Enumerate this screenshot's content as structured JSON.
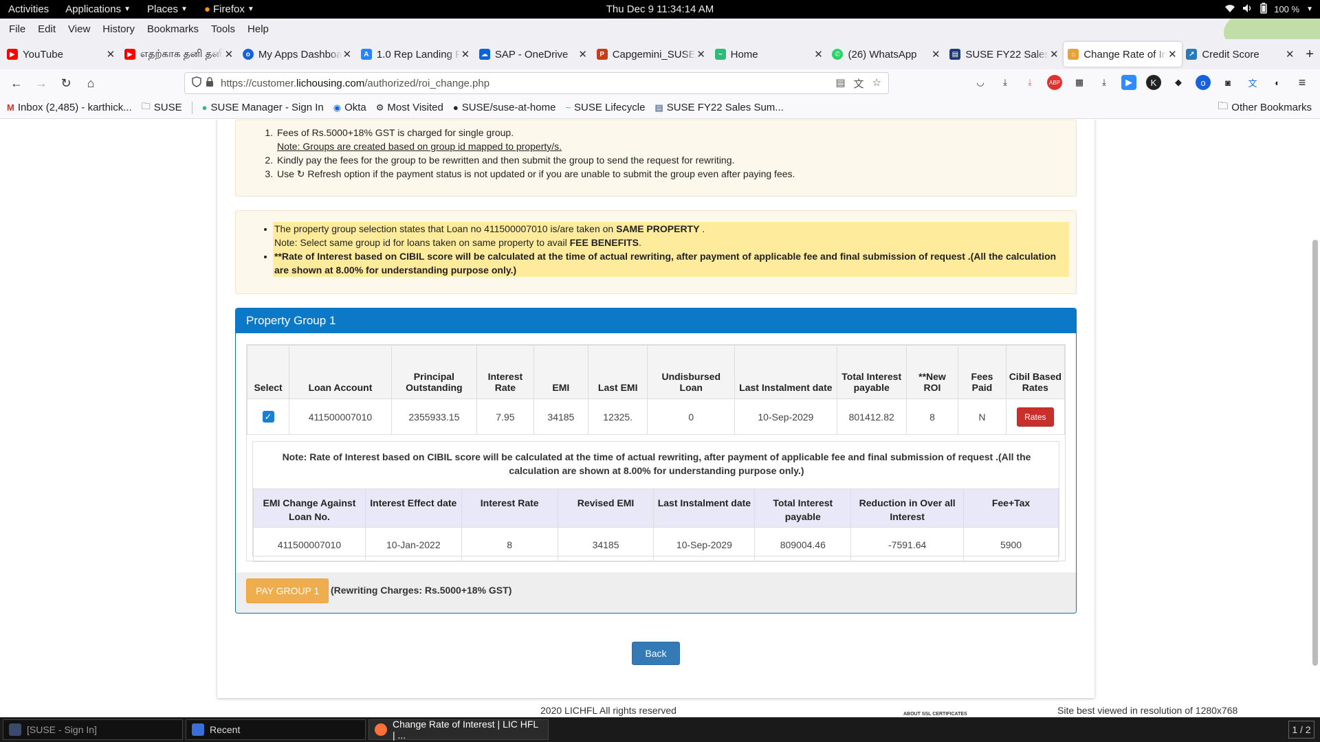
{
  "gnome": {
    "activities": "Activities",
    "applications": "Applications",
    "places": "Places",
    "firefox": "Firefox",
    "clock": "Thu Dec 9  11:34:14 AM",
    "battery": "100 %"
  },
  "menubar": [
    "File",
    "Edit",
    "View",
    "History",
    "Bookmarks",
    "Tools",
    "Help"
  ],
  "tabs": [
    {
      "label": "YouTube",
      "icon": "youtube-icon",
      "color": "#ff0000"
    },
    {
      "label": "எதற்காக தனி தனி",
      "icon": "youtube-icon",
      "color": "#ff0000"
    },
    {
      "label": "My Apps Dashboard",
      "icon": "okta-icon",
      "color": "#1662dd"
    },
    {
      "label": "1.0 Rep Landing P",
      "icon": "confluence-icon",
      "color": "#2684ff"
    },
    {
      "label": "SAP - OneDrive",
      "icon": "onedrive-icon",
      "color": "#0a64d6"
    },
    {
      "label": "Capgemini_SUSE",
      "icon": "powerpoint-icon",
      "color": "#c43e1c"
    },
    {
      "label": "Home",
      "icon": "suse-icon",
      "color": "#30ba78"
    },
    {
      "label": "(26) WhatsApp",
      "icon": "whatsapp-icon",
      "color": "#25d366"
    },
    {
      "label": "SUSE FY22 Sales",
      "icon": "report-icon",
      "color": "#1f3b73"
    },
    {
      "label": "Change Rate of In",
      "icon": "lic-icon",
      "color": "#e8a23b"
    },
    {
      "label": "Credit Score",
      "icon": "credit-icon",
      "color": "#2a7ab8"
    }
  ],
  "url": {
    "prefix": "https://customer.",
    "host": "lichousing.com",
    "path": "/authorized/roi_change.php"
  },
  "bookmarks": [
    {
      "label": "Inbox (2,485) - karthick...",
      "icon": "gmail-icon"
    },
    {
      "label": "SUSE",
      "icon": "folder-icon"
    },
    {
      "label": "SUSE Manager - Sign In",
      "icon": "suse-icon"
    },
    {
      "label": "Okta",
      "icon": "okta-icon"
    },
    {
      "label": "Most Visited",
      "icon": "gear-icon"
    },
    {
      "label": "SUSE/suse-at-home",
      "icon": "github-icon"
    },
    {
      "label": "SUSE Lifecycle",
      "icon": "suse-icon"
    },
    {
      "label": "SUSE FY22 Sales Sum...",
      "icon": "report-icon"
    }
  ],
  "other_bookmarks": "Other Bookmarks",
  "instructions": {
    "item1": "Fees of Rs.5000+18% GST is charged for single group.",
    "item1_note": "Note: Groups are created based on group id mapped to property/s.",
    "item2": "Kindly pay the fees for the group to be rewritten and then submit the group to send the request for rewriting.",
    "item3_pre": "Use",
    "item3_post": "Refresh option if the payment status is not updated or if you are unable to submit the group even after paying fees."
  },
  "property_note": {
    "line1_pre": "The property group selection states that Loan no 411500007010 is/are taken on ",
    "line1_bold": "SAME PROPERTY",
    "line1_post": " .",
    "line2_pre": "Note: Select same group id for loans taken on same property to avail ",
    "line2_bold": "FEE BENEFITS",
    "line2_post": ".",
    "line3": "**Rate of Interest based on CIBIL score will be calculated at the time of actual rewriting, after payment of applicable fee and final submission of request .(All the calculation are shown at 8.00% for understanding purpose only.)"
  },
  "group": {
    "title": "Property Group 1",
    "loan_headers": [
      "Select",
      "Loan Account",
      "Principal Outstanding",
      "Interest Rate",
      "EMI",
      "Last EMI",
      "Undisbursed Loan",
      "Last Instalment date",
      "Total Interest payable",
      "**New ROI",
      "Fees Paid",
      "Cibil Based Rates"
    ],
    "loan_row": {
      "account": "411500007010",
      "principal": "2355933.15",
      "rate": "7.95",
      "emi": "34185",
      "last_emi": "12325.",
      "undisbursed": "0",
      "last_date": "10-Sep-2029",
      "total_interest": "801412.82",
      "new_roi": "8",
      "fees_paid": "N",
      "rates_btn": "Rates"
    },
    "sub_note": "Note: Rate of Interest based on CIBIL score will be calculated at the time of actual rewriting, after payment of applicable fee and final submission of request .(All the calculation are shown at 8.00% for understanding purpose only.)",
    "rewrite_headers": [
      "EMI Change Against Loan No.",
      "Interest Effect date",
      "Interest Rate",
      "Revised EMI",
      "Last Instalment date",
      "Total Interest payable",
      "Reduction in Over all Interest",
      "Fee+Tax"
    ],
    "rewrite_row": [
      "411500007010",
      "10-Jan-2022",
      "8",
      "34185",
      "10-Sep-2029",
      "809004.46",
      "-7591.64",
      "5900"
    ],
    "pay_button": "PAY GROUP 1",
    "pay_charges": "(Rewriting Charges: Rs.5000+18% GST)"
  },
  "back_button": "Back",
  "footer": {
    "copyright": "2020 LICHFL All rights reserved",
    "ssl": "ABOUT SSL CERTIFICATES",
    "resolution": "Site best viewed in resolution of 1280x768"
  },
  "taskbar": [
    {
      "label": "[SUSE - Sign In]",
      "icon": "suse-icon"
    },
    {
      "label": "Recent",
      "icon": "files-icon"
    },
    {
      "label": "Change Rate of Interest | LIC HFL | ...",
      "icon": "firefox-icon"
    }
  ],
  "pager": "1 / 2",
  "colors": {
    "panel_header": "#0b79c7",
    "pay_button": "#f0ad4e",
    "rates_button": "#c9302c",
    "back_button": "#337ab7",
    "highlight": "#ffeb9c"
  }
}
